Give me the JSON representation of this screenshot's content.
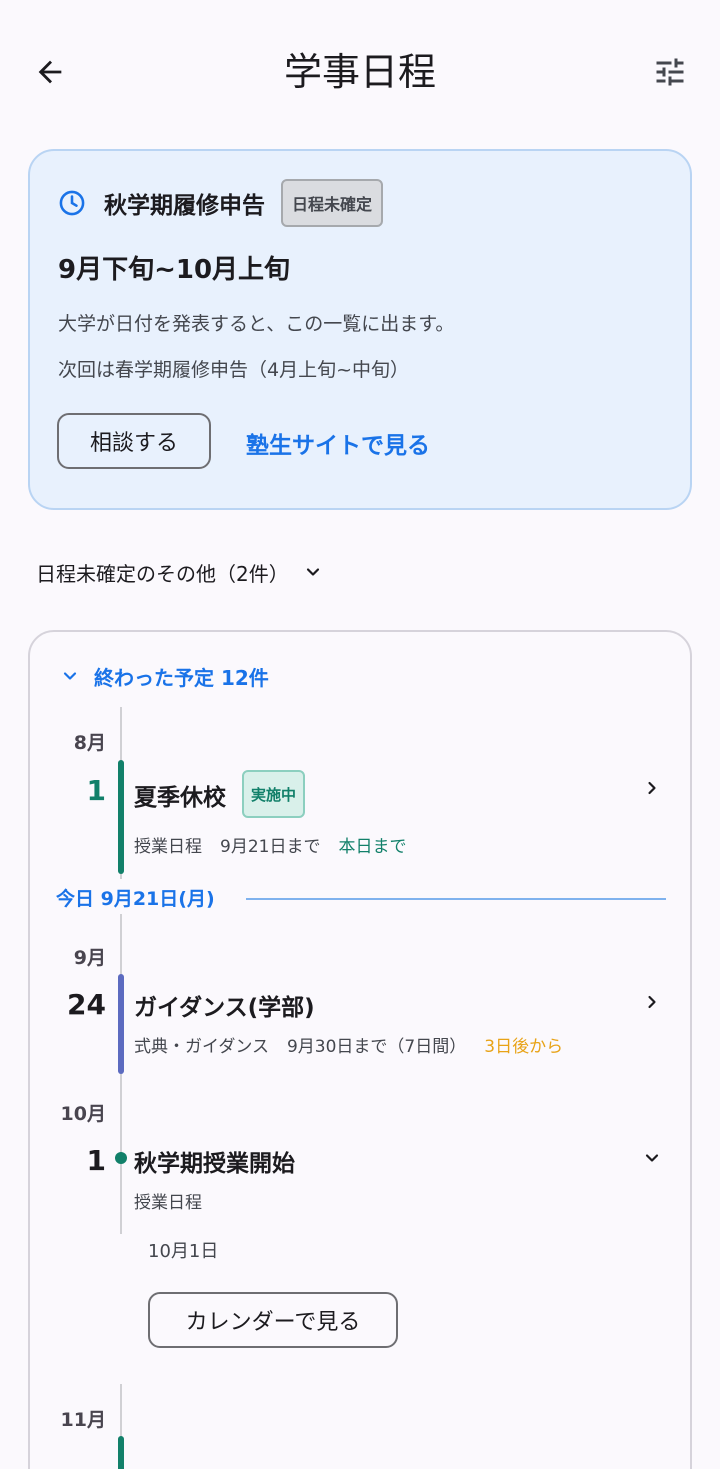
{
  "header": {
    "title": "学事日程"
  },
  "notice": {
    "title": "秋学期履修申告",
    "badge": "日程未確定",
    "range": "9月下旬~10月上旬",
    "description": "大学が日付を発表すると、この一覧に出ます。",
    "next": "次回は春学期履修申告（4月上旬~中旬）",
    "consult_label": "相談する",
    "site_link_label": "塾生サイトで見る",
    "accent_color": "#1a73e8"
  },
  "others": {
    "label": "日程未確定のその他（2件）"
  },
  "timeline": {
    "past_toggle_label": "終わった予定 12件",
    "today_label": "今日 9月21日(月)",
    "events": [
      {
        "month": "8月",
        "day": "1",
        "title": "夏季休校",
        "badge": "実施中",
        "category": "授業日程",
        "until": "9月21日まで",
        "status": "本日まで",
        "status_color": "#12806a",
        "bar_color": "#12806a"
      },
      {
        "month": "9月",
        "day": "24",
        "title": "ガイダンス(学部)",
        "category": "式典・ガイダンス",
        "until": "9月30日まで（7日間）",
        "status": "3日後から",
        "status_color": "#e8a317",
        "bar_color": "#5c6bc0"
      },
      {
        "month": "10月",
        "day": "1",
        "title": "秋学期授業開始",
        "category": "授業日程",
        "date_detail": "10月1日",
        "calendar_label": "カレンダーで見る"
      },
      {
        "month": "11月"
      }
    ]
  }
}
